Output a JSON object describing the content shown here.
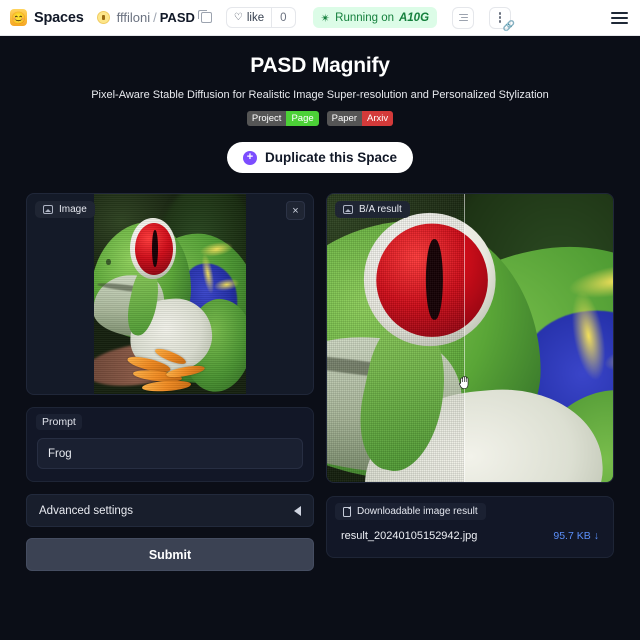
{
  "hf_bar": {
    "avatar_icon": "smiling-face-avatar",
    "spaces_label": "Spaces",
    "repo_owner": "fffiloni",
    "repo_separator": "/",
    "repo_name": "PASD",
    "copy_icon": "copy-icon",
    "like_label": "like",
    "like_icon": "heart-icon",
    "like_count": "0",
    "runtime_icon": "scissors-icon",
    "runtime_text": "Running on",
    "runtime_hardware": "A10G",
    "logs_button_icon": "logs-icon",
    "menu_button_icon": "vertical-dots-icon",
    "link_overlay_icon": "link-icon",
    "hamburger_icon": "hamburger-menu-icon"
  },
  "app": {
    "title": "PASD Magnify",
    "subtitle": "Pixel-Aware Stable Diffusion for Realistic Image Super-resolution and Personalized Stylization",
    "badges": [
      {
        "label": "Project",
        "value": "Page",
        "color": "#4cd137"
      },
      {
        "label": "Paper",
        "value": "Arxiv",
        "color": "#d33a3a"
      }
    ],
    "duplicate_button": {
      "label": "Duplicate this Space",
      "icon": "duplicate-plus-icon",
      "icon_glyph": "+",
      "accent": "#7c4dff"
    }
  },
  "left_column": {
    "image_panel": {
      "label": "Image",
      "icon": "image-icon",
      "close_icon": "close-icon",
      "close_glyph": "×",
      "alt": "red-eyed tree frog photo"
    },
    "prompt": {
      "label": "Prompt",
      "value": "Frog",
      "placeholder": "Prompt"
    },
    "advanced_settings": {
      "label": "Advanced settings",
      "chevron_icon": "chevron-left-icon",
      "expanded": "false"
    },
    "submit": {
      "label": "Submit"
    }
  },
  "right_column": {
    "result_panel": {
      "label": "B/A result",
      "icon": "image-icon",
      "alt": "before/after comparison of upscaled frog image",
      "slider_position_percent": 48,
      "cursor_icon": "grab-hand-cursor"
    },
    "download": {
      "label": "Downloadable image result",
      "label_icon": "file-icon",
      "filename": "result_20240105152942.jpg",
      "filesize": "95.7 KB",
      "download_icon": "download-arrow-icon",
      "download_glyph": "↓",
      "link_color": "#5b8ff9"
    }
  }
}
